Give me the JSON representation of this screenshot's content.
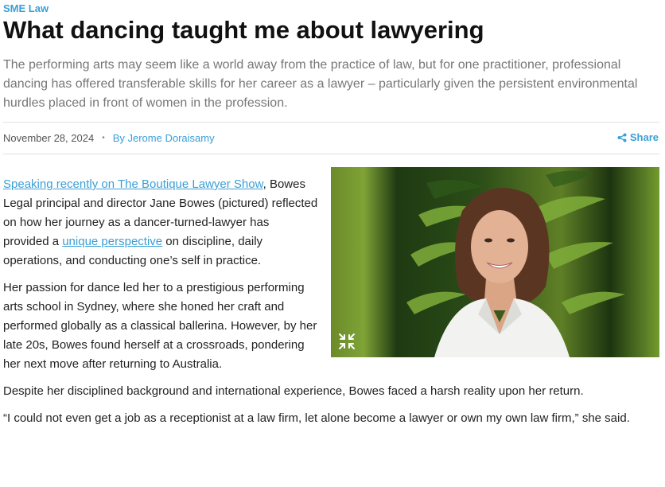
{
  "header": {
    "category": "SME Law",
    "title": "What dancing taught me about lawyering",
    "standfirst": "The performing arts may seem like a world away from the practice of law, but for one practitioner, professional dancing has offered transferable skills for her career as a lawyer – particularly given the persistent environmental hurdles placed in front of women in the profession."
  },
  "meta": {
    "date": "November 28, 2024",
    "separator": "•",
    "author": "By Jerome Doraisamy",
    "share_label": "Share"
  },
  "image": {
    "expand_icon": "collapse-arrows-icon"
  },
  "article": {
    "p1": {
      "link1": "Speaking recently on The Boutique Lawyer Show",
      "text1": ", Bowes Legal principal and director Jane Bowes (pictured) reflected on how her journey as a dancer-turned-lawyer has provided a ",
      "link2": "unique perspective",
      "text2": " on discipline, daily operations, and conducting one’s self in practice."
    },
    "p2": "Her passion for dance led her to a prestigious performing arts school in Sydney, where she honed her craft and performed globally as a classical ballerina. However, by her late 20s, Bowes found herself at a crossroads, pondering her next move after returning to Australia.",
    "p3": "Despite her disciplined background and international experience, Bowes faced a harsh reality upon her return.",
    "p4": "“I could not even get a job as a receptionist at a law firm, let alone become a lawyer or own my own law firm,” she said."
  },
  "colors": {
    "accent": "#3a9fd6",
    "title": "#111111",
    "standfirst": "#777777"
  }
}
